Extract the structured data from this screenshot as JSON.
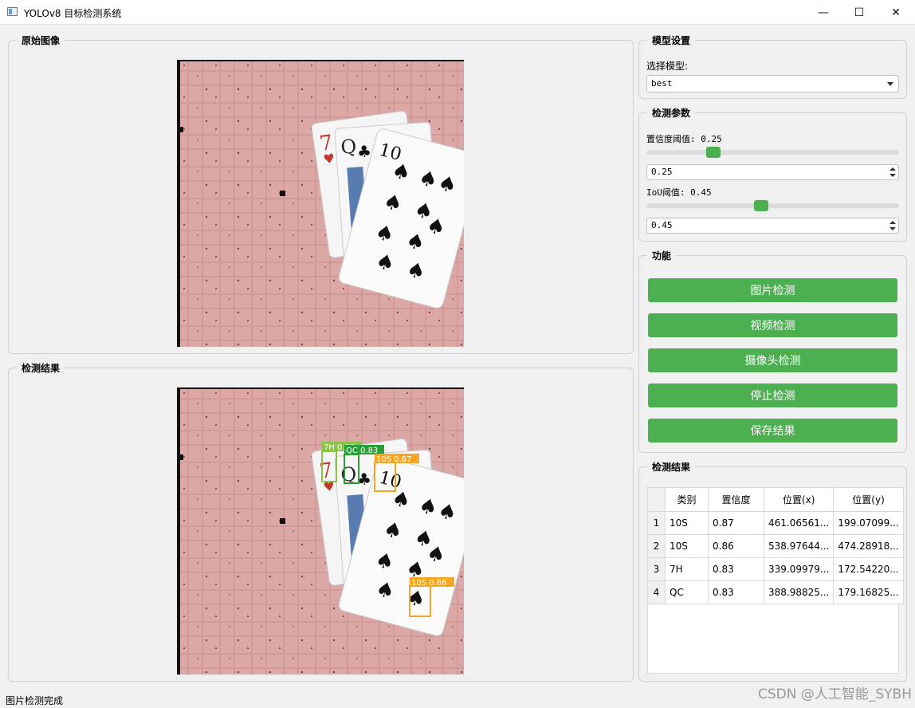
{
  "window": {
    "title": "YOLOv8 目标检测系统",
    "min": "—",
    "max": "☐",
    "close": "✕"
  },
  "panels": {
    "original": "原始图像",
    "result": "检测结果"
  },
  "model": {
    "group": "模型设置",
    "label": "选择模型:",
    "value": "best"
  },
  "params": {
    "group": "检测参数",
    "conf_label": "置信度阈值: 0.25",
    "conf_value": "0.25",
    "conf_level": 0.25,
    "iou_label": "IoU阈值: 0.45",
    "iou_value": "0.45",
    "iou_level": 0.45
  },
  "functions": {
    "group": "功能",
    "buttons": [
      "图片检测",
      "视频检测",
      "摄像头检测",
      "停止检测",
      "保存结果"
    ]
  },
  "results": {
    "group": "检测结果",
    "headers": [
      "类别",
      "置信度",
      "位置(x)",
      "位置(y)"
    ],
    "rows": [
      {
        "n": "1",
        "cls": "10S",
        "conf": "0.87",
        "x": "461.06561...",
        "y": "199.07099..."
      },
      {
        "n": "2",
        "cls": "10S",
        "conf": "0.86",
        "x": "538.97644...",
        "y": "474.28918..."
      },
      {
        "n": "3",
        "cls": "7H",
        "conf": "0.83",
        "x": "339.09979...",
        "y": "172.54220..."
      },
      {
        "n": "4",
        "cls": "QC",
        "conf": "0.83",
        "x": "388.98825...",
        "y": "179.16825..."
      }
    ]
  },
  "detections": [
    "7H 0.83",
    "QC 0.83",
    "10S 0.87",
    "10S 0.86"
  ],
  "colors": {
    "accent": "#4caf50",
    "box_7h": "#8bc34a",
    "box_qc": "#2e9d3c",
    "box_10s": "#f5a623"
  },
  "status": "图片检测完成",
  "watermark": "CSDN @人工智能_SYBH"
}
